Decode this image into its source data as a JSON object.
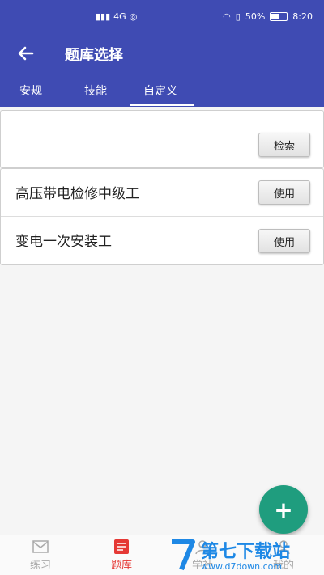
{
  "status_bar": {
    "network": "4G",
    "battery": "50%",
    "time": "8:20"
  },
  "appbar": {
    "title": "题库选择"
  },
  "tabs": [
    {
      "label": "安规"
    },
    {
      "label": "技能"
    },
    {
      "label": "自定义"
    }
  ],
  "active_tab": 2,
  "search": {
    "value": "",
    "button": "检索"
  },
  "banks": [
    {
      "name": "高压带电检修中级工",
      "button": "使用"
    },
    {
      "name": "变电一次安装工",
      "button": "使用"
    }
  ],
  "fab": {
    "symbol": "+"
  },
  "bottom_nav": [
    {
      "label": "练习",
      "icon": "envelope-icon"
    },
    {
      "label": "题库",
      "icon": "document-icon"
    },
    {
      "label": "学社",
      "icon": "community-icon"
    },
    {
      "label": "我的",
      "icon": "user-icon"
    }
  ],
  "watermark": {
    "text": "第七下载站",
    "url": "www.d7down.com"
  },
  "colors": {
    "primary": "#3f4bb3",
    "accent": "#1f9d7e",
    "active_nav": "#e53935"
  }
}
